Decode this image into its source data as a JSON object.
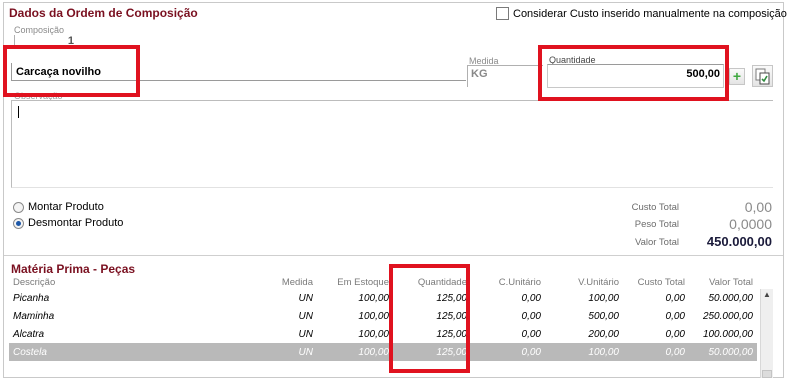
{
  "header": {
    "title": "Dados da Ordem de Composição",
    "manual_cost_label": "Considerar Custo inserido manualmente na composição"
  },
  "composicao": {
    "label": "Composição",
    "value": "1"
  },
  "product": {
    "name": "Carcaça novilho"
  },
  "medida": {
    "label": "Medida",
    "value": "KG"
  },
  "quantidade": {
    "label": "Quantidade",
    "value": "500,00"
  },
  "observacao": {
    "label": "Observação"
  },
  "options": {
    "montar": "Montar Produto",
    "desmontar": "Desmontar Produto",
    "selected": "desmontar"
  },
  "totals": {
    "custo_label": "Custo Total",
    "custo_value": "0,00",
    "peso_label": "Peso Total",
    "peso_value": "0,0000",
    "valor_label": "Valor Total",
    "valor_value": "450.000,00"
  },
  "materia_prima": {
    "title": "Matéria Prima - Peças",
    "columns": [
      "Descrição",
      "Medida",
      "Em Estoque",
      "Quantidade",
      "C.Unitário",
      "V.Unitário",
      "Custo Total",
      "Valor Total"
    ],
    "rows": [
      [
        "Picanha",
        "UN",
        "100,00",
        "125,00",
        "0,00",
        "100,00",
        "0,00",
        "50.000,00"
      ],
      [
        "Maminha",
        "UN",
        "100,00",
        "125,00",
        "0,00",
        "500,00",
        "0,00",
        "250.000,00"
      ],
      [
        "Alcatra",
        "UN",
        "100,00",
        "125,00",
        "0,00",
        "200,00",
        "0,00",
        "100.000,00"
      ],
      [
        "Costela",
        "UN",
        "100,00",
        "125,00",
        "0,00",
        "100,00",
        "0,00",
        "50.000,00"
      ]
    ]
  },
  "icons": {
    "add": "plus-icon",
    "copy": "copy-document-icon",
    "scroll_up": "scroll-up-arrow-icon"
  },
  "colors": {
    "section_title": "#7a1020",
    "highlight_box": "#e0121f",
    "selected_row": "#b9b9b9"
  }
}
